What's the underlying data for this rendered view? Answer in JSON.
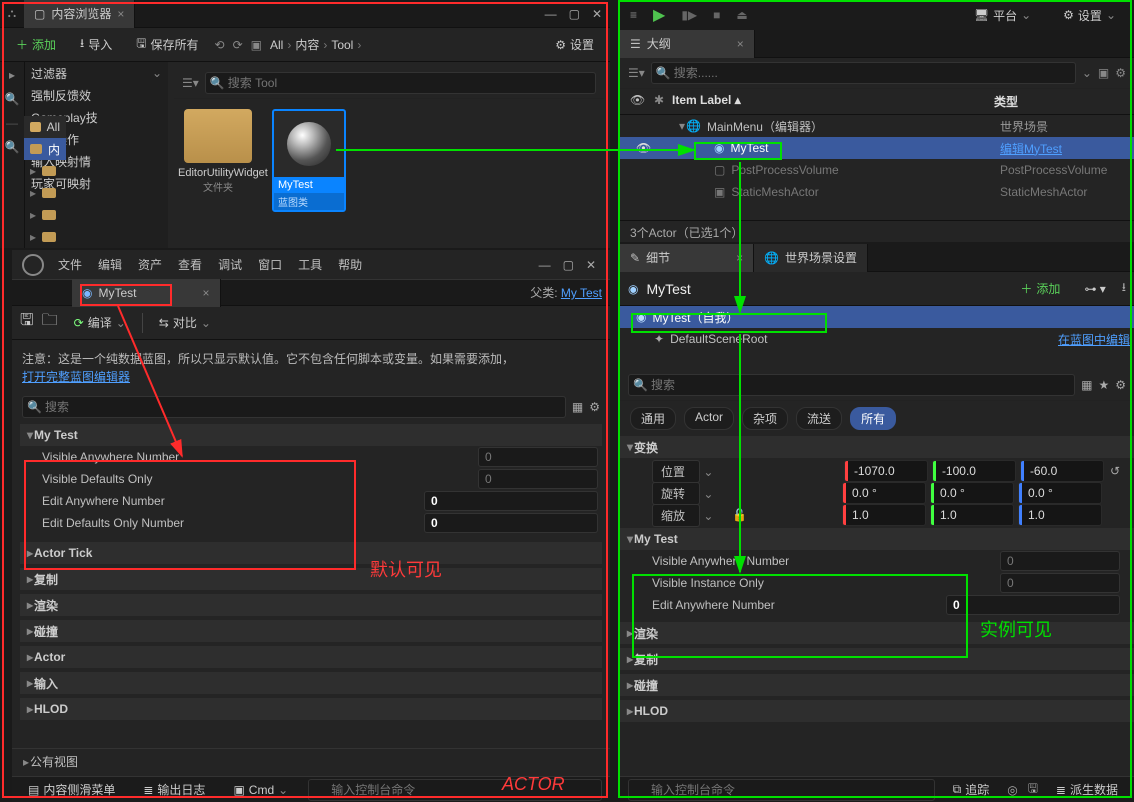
{
  "content_browser": {
    "title": "内容浏览器",
    "add": "添加",
    "import": "导入",
    "save_all": "保存所有",
    "path_all": "All",
    "crumbs": [
      "All",
      "内容",
      "Tool"
    ],
    "settings": "设置",
    "search_placeholder": "搜索 Tool",
    "filters_label": "过滤器",
    "sidebar": {
      "all": "All",
      "content": "内",
      "filters": [
        "强制反馈效",
        "Gameplay技",
        "输入操作",
        "输入映射情",
        "玩家可映射"
      ]
    },
    "assets": {
      "folder_name": "EditorUtilityWidget",
      "folder_sub": "文件夹",
      "bp_name": "MyTest",
      "bp_sub": "蓝图类"
    }
  },
  "bp_editor": {
    "menus": [
      "文件",
      "编辑",
      "资产",
      "查看",
      "调试",
      "窗口",
      "工具",
      "帮助"
    ],
    "tab": "MyTest",
    "parent_prefix": "父类:",
    "parent": "My Test",
    "compile": "编译",
    "diff": "对比",
    "note": "注意：这是一个纯数据蓝图，所以只显示默认值。它不包含任何脚本或变量。如果需要添加，",
    "note_link": "打开完整蓝图编辑器",
    "search_placeholder": "搜索",
    "sections": {
      "mytest": "My Test",
      "props": [
        {
          "name": "Visible Anywhere Number",
          "value": "0",
          "readonly": true
        },
        {
          "name": "Visible Defaults Only",
          "value": "0",
          "readonly": true
        },
        {
          "name": "Edit Anywhere Number",
          "value": "0",
          "readonly": false
        },
        {
          "name": "Edit Defaults Only Number",
          "value": "0",
          "readonly": false
        }
      ],
      "collapsed": [
        "Actor Tick",
        "复制",
        "渲染",
        "碰撞",
        "Actor",
        "输入",
        "HLOD"
      ]
    },
    "public_view": "公有视图",
    "footer": {
      "side_menu": "内容侧滑菜单",
      "output_log": "输出日志",
      "cmd": "Cmd",
      "cmd_placeholder": "输入控制台命令"
    }
  },
  "right_top": {
    "platform": "平台",
    "settings": "设置"
  },
  "outliner": {
    "title": "大纲",
    "search_placeholder": "搜索......",
    "col_item": "Item Label",
    "col_type": "类型",
    "rows": [
      {
        "name": "MainMenu（编辑器）",
        "type": "世界场景",
        "indent": 0,
        "expander": true
      },
      {
        "name": "MyTest",
        "type": "编辑MyTest",
        "indent": 1,
        "selected": true,
        "type_link": true
      },
      {
        "name": "PostProcessVolume",
        "type": "PostProcessVolume",
        "indent": 1,
        "dim": true
      },
      {
        "name": "StaticMeshActor",
        "type": "StaticMeshActor",
        "indent": 1,
        "dim": true
      }
    ],
    "status": "3个Actor（已选1个）"
  },
  "details": {
    "tab1": "细节",
    "tab2": "世界场景设置",
    "actor_name": "MyTest",
    "add": "添加",
    "self": "MyTest（自我）",
    "root": "DefaultSceneRoot",
    "edit_in_bp": "在蓝图中编辑",
    "search_placeholder": "搜索",
    "filter_pills": [
      "通用",
      "Actor",
      "杂项",
      "流送",
      "所有"
    ],
    "active_pill": 4,
    "variables_hdr": "变换",
    "vec_labels": [
      "位置",
      "旋转",
      "缩放"
    ],
    "vecs": {
      "pos": [
        "-1070.0",
        "-100.0",
        "-60.0"
      ],
      "rot": [
        "0.0 °",
        "0.0 °",
        "0.0 °"
      ],
      "scale": [
        "1.0",
        "1.0",
        "1.0"
      ]
    },
    "mytest_hdr": "My Test",
    "mytest_props": [
      {
        "name": "Visible Anywhere Number",
        "value": "0",
        "readonly": true
      },
      {
        "name": "Visible Instance Only",
        "value": "0",
        "readonly": true
      },
      {
        "name": "Edit Anywhere Number",
        "value": "0",
        "readonly": false
      }
    ],
    "collapsed": [
      "渲染",
      "复制",
      "碰撞",
      "HLOD"
    ],
    "cmd_placeholder": "输入控制台命令",
    "trace": "追踪",
    "derived": "派生数据"
  },
  "annotations": {
    "default_visible": "默认可见",
    "instance_visible": "实例可见",
    "actor_label": "ACTOR"
  }
}
